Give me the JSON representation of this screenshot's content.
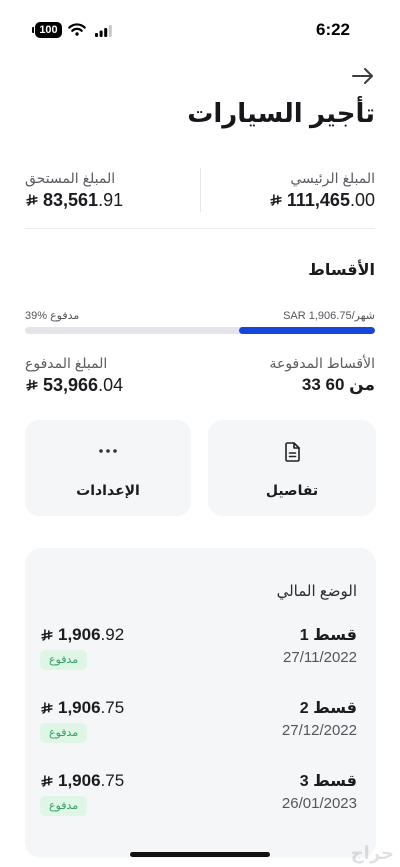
{
  "status_bar": {
    "time": "6:22",
    "battery": "100",
    "icons": [
      "battery-icon",
      "wifi-icon",
      "cellular-signal-icon"
    ]
  },
  "header": {
    "back_icon": "back-arrow-icon",
    "title": "تأجير السيارات"
  },
  "summary": {
    "principal": {
      "label": "المبلغ الرئيسي",
      "whole": "111,465",
      "decimal": ".00",
      "currency_icon": "riyal-icon"
    },
    "due": {
      "label": "المبلغ المستحق",
      "whole": "83,561",
      "decimal": ".91",
      "currency_icon": "riyal-icon"
    }
  },
  "installments": {
    "heading": "الأقساط",
    "monthly_label": "SAR 1,906.75/شهر",
    "paid_label": "39% مدفوع",
    "paid_fraction": 0.39,
    "paid_count": {
      "label": "الأقساط المدفوعة",
      "value": "33 من 60"
    },
    "paid_amount": {
      "label": "المبلغ المدفوع",
      "whole": "53,966",
      "decimal": ".04",
      "currency_icon": "riyal-icon"
    }
  },
  "actions": [
    {
      "label": "تفاصيل",
      "icon": "document-icon"
    },
    {
      "label": "الإعدادات",
      "icon": "more-dots-icon"
    }
  ],
  "financial_status": {
    "heading": "الوضع المالي",
    "items": [
      {
        "title": "قسط 1",
        "date": "27/11/2022",
        "whole": "1,906",
        "decimal": ".92",
        "status": "مدفوع"
      },
      {
        "title": "قسط 2",
        "date": "27/12/2022",
        "whole": "1,906",
        "decimal": ".75",
        "status": "مدفوع"
      },
      {
        "title": "قسط 3",
        "date": "26/01/2023",
        "whole": "1,906",
        "decimal": ".75",
        "status": "مدفوع"
      }
    ]
  },
  "colors": {
    "accent": "#1746d6",
    "card_bg": "#f5f6f8",
    "paid_badge_bg": "#dff5e6",
    "paid_badge_text": "#34a062"
  },
  "watermark": "حراج"
}
